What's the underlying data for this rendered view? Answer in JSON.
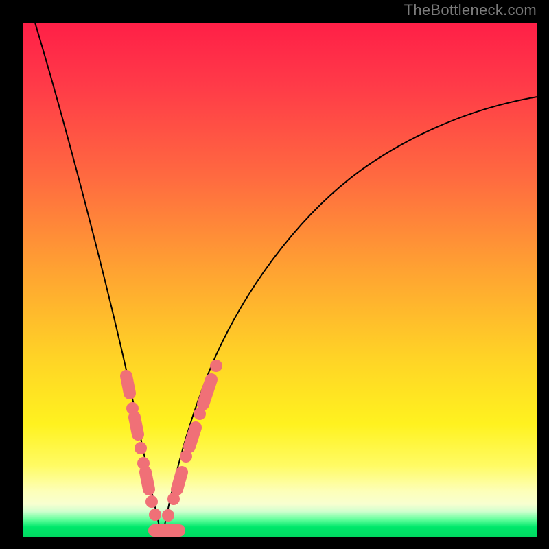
{
  "watermark": "TheBottleneck.com",
  "colors": {
    "dot": "#f07077",
    "curve": "#000000"
  },
  "chart_data": {
    "type": "line",
    "title": "",
    "xlabel": "",
    "ylabel": "",
    "xlim": [
      0,
      100
    ],
    "ylim": [
      0,
      100
    ],
    "series": [
      {
        "name": "bottleneck-curve",
        "x": [
          0,
          4,
          8,
          12,
          15,
          18,
          20,
          22,
          24,
          26,
          28,
          30,
          33,
          37,
          42,
          48,
          55,
          63,
          72,
          82,
          92,
          100
        ],
        "y": [
          100,
          84,
          70,
          57,
          47,
          37,
          29,
          21,
          13,
          5,
          0,
          4,
          12,
          22,
          33,
          43,
          52,
          59,
          65,
          70,
          74,
          77
        ]
      }
    ],
    "scatter_points": {
      "name": "highlighted-range",
      "note": "Pink capsule/dot markers clustered near the curve minimum on both branches.",
      "x": [
        19,
        20,
        21,
        22,
        22.8,
        23.5,
        24.2,
        25,
        25.8,
        26.5,
        27.2,
        28,
        30,
        31,
        32,
        33,
        34,
        35,
        36
      ],
      "y": [
        32,
        28,
        24,
        19,
        15,
        12,
        9,
        6,
        3,
        0,
        2,
        4,
        9,
        12,
        16,
        20,
        24,
        28,
        33
      ]
    }
  }
}
